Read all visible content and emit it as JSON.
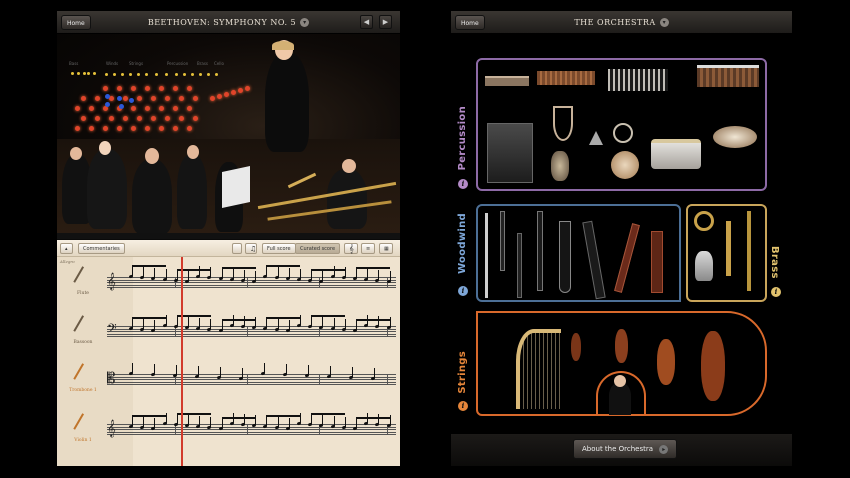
{
  "left_app": {
    "home_label": "Home",
    "title": "BEETHOVEN: SYMPHONY NO. 5",
    "dropdown_glyph": "▾",
    "prev_glyph": "◀",
    "next_glyph": "▶",
    "stat_labels": [
      "Bass",
      "Winds",
      "Strings",
      "Percussion",
      "Brass",
      "Cello"
    ],
    "score_toolbar": {
      "collapse_glyph": "▴",
      "commentaries_label": "Commentaries",
      "full_score_label": "Full score",
      "curated_score_label": "Curated score",
      "tempo_mark": "Allegro"
    },
    "staves": [
      {
        "instrument": "Flute",
        "clef": "𝄞",
        "color": "#6a5a45"
      },
      {
        "instrument": "Bassoon",
        "clef": "𝄢",
        "color": "#6a5a45"
      },
      {
        "instrument": "Trombone 1",
        "clef": "𝄡",
        "color": "#c0742a"
      },
      {
        "instrument": "Violin 1",
        "clef": "𝄞",
        "color": "#c0742a"
      }
    ],
    "colors": {
      "playhead": "#d23b2b",
      "score_paper": "#efe3cf"
    }
  },
  "right_app": {
    "home_label": "Home",
    "title": "THE ORCHESTRA",
    "dropdown_glyph": "▾",
    "sections": [
      {
        "name": "Percussion",
        "color": "#b48bc8"
      },
      {
        "name": "Woodwind",
        "color": "#7ea7d8"
      },
      {
        "name": "Brass",
        "color": "#e2c36e"
      },
      {
        "name": "Strings",
        "color": "#e6863a"
      }
    ],
    "info_glyph": "i",
    "about_label": "About the Orchestra",
    "about_glyph": "▸"
  }
}
